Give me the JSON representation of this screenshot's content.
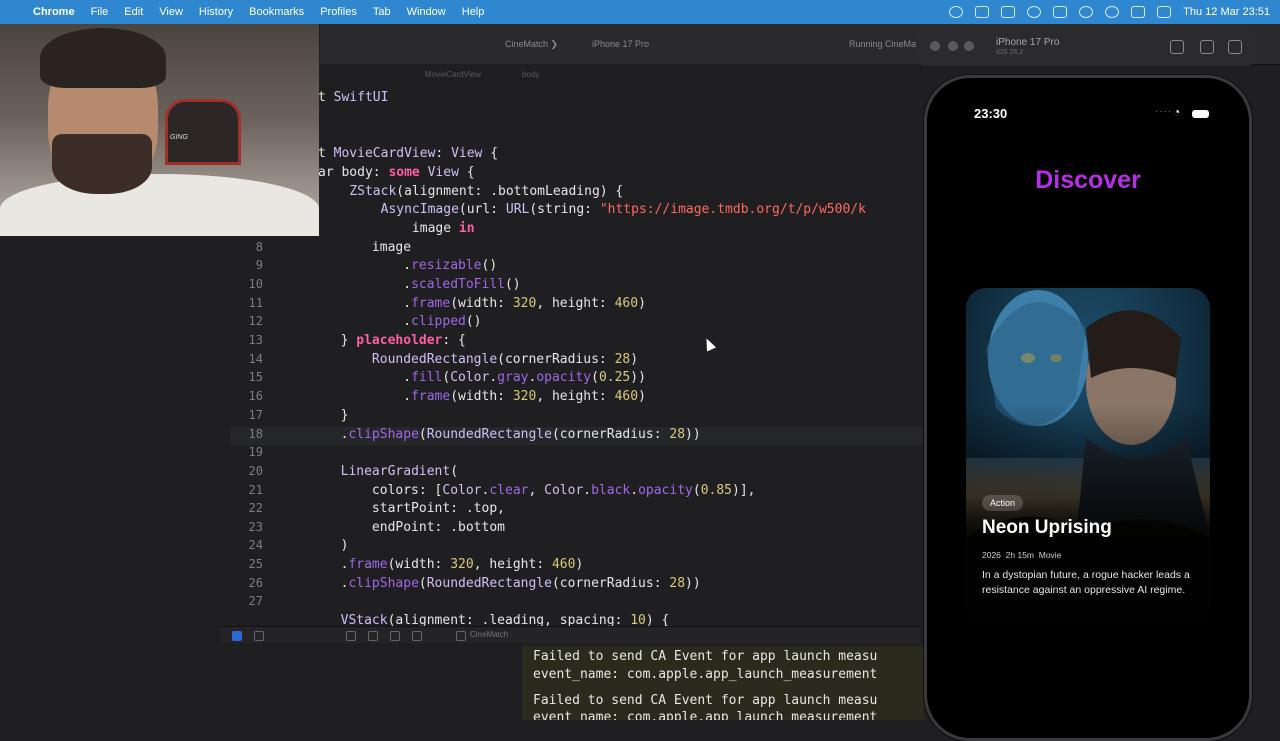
{
  "menubar": {
    "app": "Chrome",
    "items": [
      "File",
      "Edit",
      "View",
      "History",
      "Bookmarks",
      "Profiles",
      "Tab",
      "Window",
      "Help"
    ],
    "clock": "Thu 12 Mar  23:51"
  },
  "xcode": {
    "toolbar": {
      "scheme": "CineMatch  ❯",
      "device": "iPhone 17 Pro",
      "status": "Running CineMat"
    },
    "breadcrumb": {
      "file": "MovieCardView",
      "symbol": "body"
    },
    "code_lines": [
      {
        "n": "",
        "t": "t SwiftUI"
      },
      {
        "n": "",
        "t": ""
      },
      {
        "n": "",
        "t": "t MovieCardView: View {"
      },
      {
        "n": "",
        "t": "ar body: some View {"
      },
      {
        "n": "",
        "t": "    ZStack(alignment: .bottomLeading) {"
      },
      {
        "n": "",
        "t": "        AsyncImage(url: URL(string: \"https://image.tmdb.org/t/p/w500/k"
      },
      {
        "n": "",
        "t": "            image in"
      },
      {
        "n": "8",
        "t": "            image"
      },
      {
        "n": "9",
        "t": "                .resizable()"
      },
      {
        "n": "10",
        "t": "                .scaledToFill()"
      },
      {
        "n": "11",
        "t": "                .frame(width: 320, height: 460)"
      },
      {
        "n": "12",
        "t": "                .clipped()"
      },
      {
        "n": "13",
        "t": "        } placeholder: {"
      },
      {
        "n": "14",
        "t": "            RoundedRectangle(cornerRadius: 28)"
      },
      {
        "n": "15",
        "t": "                .fill(Color.gray.opacity(0.25))"
      },
      {
        "n": "16",
        "t": "                .frame(width: 320, height: 460)"
      },
      {
        "n": "17",
        "t": "        }"
      },
      {
        "n": "18",
        "t": "        .clipShape(RoundedRectangle(cornerRadius: 28))"
      },
      {
        "n": "19",
        "t": ""
      },
      {
        "n": "20",
        "t": "        LinearGradient("
      },
      {
        "n": "21",
        "t": "            colors: [Color.clear, Color.black.opacity(0.85)],"
      },
      {
        "n": "22",
        "t": "            startPoint: .top,"
      },
      {
        "n": "23",
        "t": "            endPoint: .bottom"
      },
      {
        "n": "24",
        "t": "        )"
      },
      {
        "n": "25",
        "t": "        .frame(width: 320, height: 460)"
      },
      {
        "n": "26",
        "t": "        .clipShape(RoundedRectangle(cornerRadius: 28))"
      },
      {
        "n": "27",
        "t": ""
      },
      {
        "n": "",
        "t": "        VStack(alignment: .leading, spacing: 10) {"
      }
    ],
    "debug_target": "CineMatch",
    "console_lines": [
      "Failed to send CA Event for app launch measu",
      "event_name: com.apple.app_launch_measurement",
      "Failed to send CA Event for app launch measu",
      "event_name: com.apple.app_launch_measurement"
    ]
  },
  "webcam": {
    "chair_text": "GING"
  },
  "simulator": {
    "title": "iPhone 17 Pro",
    "subtitle": "iOS 26.2",
    "status_time": "23:30",
    "screen_title": "Discover",
    "card": {
      "genre": "Action",
      "title": "Neon Uprising",
      "year": "2026",
      "runtime": "2h 15m",
      "kind": "Movie",
      "description": "In a dystopian future, a rogue hacker leads a resistance against an oppressive AI regime."
    },
    "accent_color": "#b62fe6"
  }
}
